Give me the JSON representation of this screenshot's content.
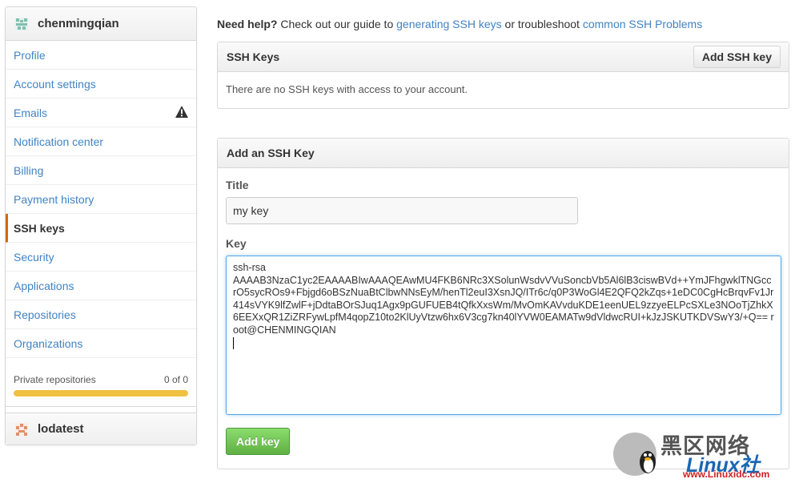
{
  "sidebar": {
    "username": "chenmingqian",
    "items": [
      {
        "label": "Profile"
      },
      {
        "label": "Account settings"
      },
      {
        "label": "Emails"
      },
      {
        "label": "Notification center"
      },
      {
        "label": "Billing"
      },
      {
        "label": "Payment history"
      },
      {
        "label": "SSH keys"
      },
      {
        "label": "Security"
      },
      {
        "label": "Applications"
      },
      {
        "label": "Repositories"
      },
      {
        "label": "Organizations"
      }
    ],
    "active_item": "SSH keys",
    "private_repos": {
      "label": "Private repositories",
      "count": "0 of 0",
      "progress": 1.0
    },
    "organization": "lodatest"
  },
  "help": {
    "prefix": "Need help?",
    "text1": " Check out our guide to ",
    "link1": "generating SSH keys",
    "text2": " or troubleshoot ",
    "link2": "common SSH Problems"
  },
  "ssh_keys": {
    "title": "SSH Keys",
    "add_button": "Add SSH key",
    "empty_message": "There are no SSH keys with access to your account."
  },
  "add_form": {
    "title": "Add an SSH Key",
    "title_label": "Title",
    "title_value": "my key",
    "key_label": "Key",
    "key_value": "ssh-rsa\nAAAAB3NzaC1yc2EAAAABIwAAAQEAwMU4FKB6NRc3XSolunWsdvVVuSoncbVb5Al6lB3ciswBVd++YmJFhgwklTNGccrO5sycROs9+Fbjgd6oBSzNuaBtClbwNNsEyM/henTl2euI3XsnJQ/ITr6c/q0P3WoGl4E2QFQ2kZqs+1eDC0CgHcBrqvFv1Jr414sVYK9lfZwlF+jDdtaBOrSJuq1Agx9pGUFUEB4tQfkXxsWm/MvOmKAVvduKDE1eenUEL9zzyeELPcSXLe3NOoTjZhkX6EEXxQR1ZiZRFywLpfM4qopZ10to2KlUyVtzw6hx6V3cg7kn40lYVW0EAMATw9dVldwcRUI+kJzJSKUTKDVSwY3/+Q== root@CHENMINGQIAN",
    "submit_button": "Add key"
  },
  "watermark": {
    "chinese": "黑区网络",
    "brand": "Linux社",
    "url": "www.Linuxidc.com"
  },
  "colors": {
    "link": "#4183c4",
    "active_border": "#d26911",
    "progress": "#f0c040",
    "green_button": "#6cc644"
  }
}
